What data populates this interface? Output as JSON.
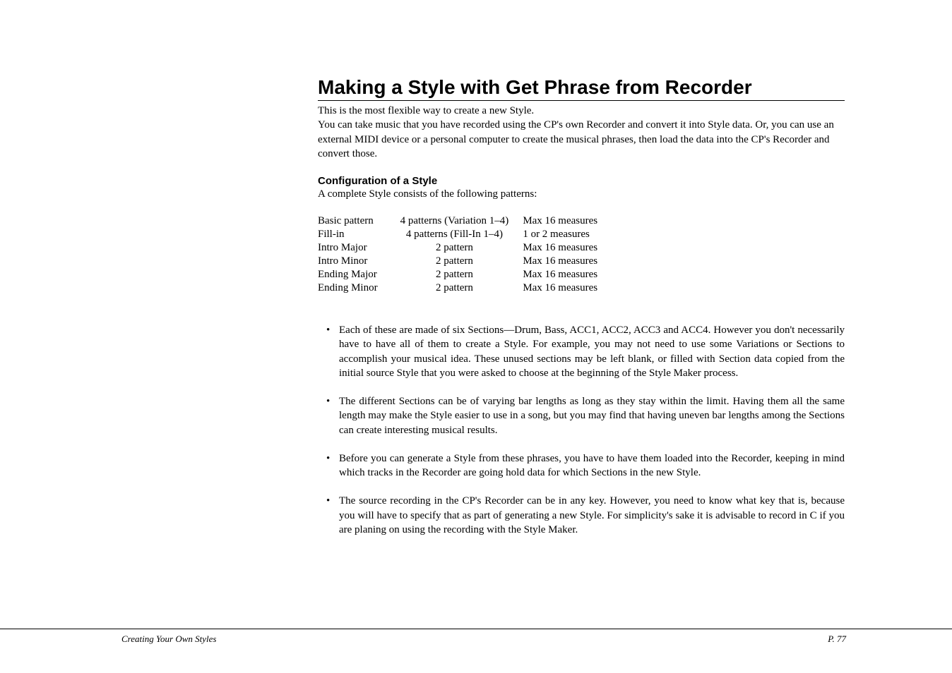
{
  "heading": "Making a Style with Get Phrase from Recorder",
  "intro": "This is the most flexible way to create a new Style.\nYou can take music that you have recorded using the CP's own Recorder and convert it into Style data. Or, you can use an external MIDI device or a personal computer to create the musical phrases, then load the data into the CP's Recorder and convert those.",
  "config": {
    "subheading": "Configuration of a Style",
    "desc": "A complete Style consists of the following patterns:",
    "rows": [
      {
        "name": "Basic pattern",
        "patterns": "4 patterns (Variation 1–4)",
        "measures": "Max 16 measures"
      },
      {
        "name": "Fill-in",
        "patterns": "4 patterns (Fill-In 1–4)",
        "measures": "1 or 2 measures"
      },
      {
        "name": "Intro Major",
        "patterns": "2 pattern",
        "measures": "Max 16 measures"
      },
      {
        "name": "Intro Minor",
        "patterns": "2 pattern",
        "measures": "Max 16 measures"
      },
      {
        "name": "Ending Major",
        "patterns": "2 pattern",
        "measures": "Max 16 measures"
      },
      {
        "name": "Ending Minor",
        "patterns": "2 pattern",
        "measures": "Max 16 measures"
      }
    ]
  },
  "bullets": [
    "Each of these are made of six Sections—Drum, Bass, ACC1, ACC2, ACC3 and ACC4.  However you don't necessarily have to have all of them to create a Style.  For example, you may not need to use some Variations or Sections to accomplish your musical idea.  These unused sections may be left blank, or filled with Section data copied from the initial source Style that you were asked to choose at the beginning of the Style Maker process.",
    "The different Sections can be of varying bar lengths as long as they stay within the limit.  Having them all the same length may make the Style easier to use in a song, but you may find that having uneven bar lengths among the Sections can create interesting musical results.",
    "Before you can generate a Style from these phrases, you have to have them loaded into the Recorder, keeping in mind which tracks in the Recorder are going hold data for which Sections in the new Style.",
    "The source recording in the CP's Recorder can be in any key.  However, you need to know what key that is, because you will have to specify that as part of generating a new Style.  For simplicity's sake it is advisable to record in C if you are planing on using the recording with the Style Maker."
  ],
  "footer": {
    "left": "Creating Your Own Styles",
    "right": "P. 77"
  }
}
